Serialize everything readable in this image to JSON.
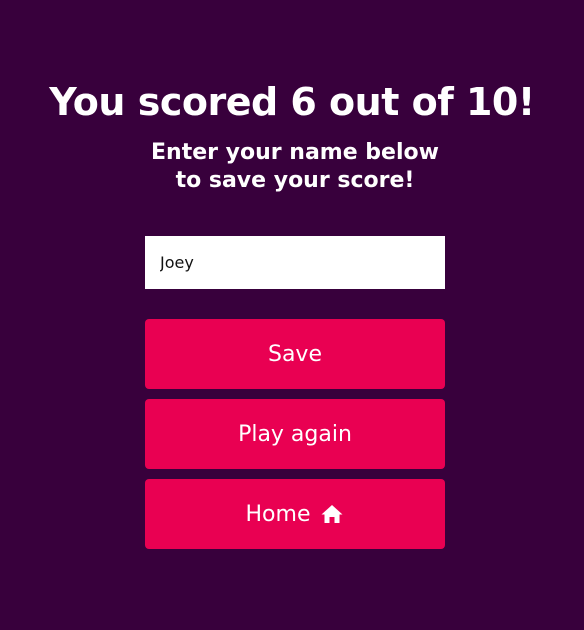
{
  "end_screen": {
    "title": "You scored 6 out of 10!",
    "subtitle": "Enter your name below to save your score!",
    "name_input": {
      "value": "Joey",
      "placeholder": ""
    },
    "buttons": {
      "save_label": "Save",
      "play_again_label": "Play again",
      "home_label": "Home",
      "home_icon": "home-icon"
    }
  },
  "colors": {
    "background": "#38003c",
    "accent": "#e90052",
    "text": "#ffffff"
  }
}
